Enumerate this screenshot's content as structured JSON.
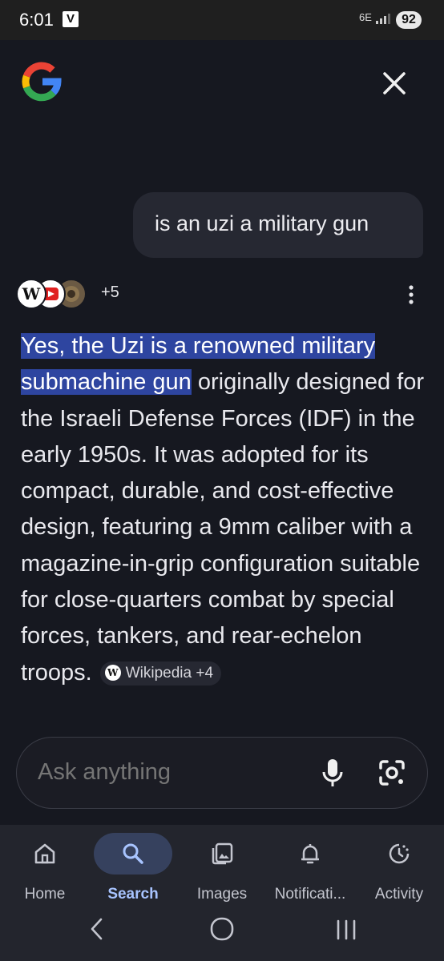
{
  "status": {
    "time": "6:01",
    "app_badge": "V",
    "network": "6E",
    "battery": "92"
  },
  "header": {
    "logo": "google-g-logo",
    "close_icon": "close-icon"
  },
  "conversation": {
    "query": "is an uzi a military gun",
    "sources": {
      "icons": [
        "wikipedia-icon",
        "youtube-icon",
        "seal-icon"
      ],
      "more": "+5"
    },
    "answer": {
      "highlight": "Yes, the Uzi is a renowned military submachine gun",
      "body": " originally designed for the Israeli Defense Forces (IDF) in the early 1950s. It was adopted for its compact, durable, and cost-effective design, featuring a 9mm caliber with a magazine-in-grip configuration suitable for close-quarters combat by special forces, tankers, and rear-echelon troops.",
      "citation": "Wikipedia +4"
    }
  },
  "ask": {
    "placeholder": "Ask anything"
  },
  "nav": {
    "items": [
      {
        "label": "Home",
        "icon": "home-icon"
      },
      {
        "label": "Search",
        "icon": "search-icon",
        "active": true
      },
      {
        "label": "Images",
        "icon": "images-icon"
      },
      {
        "label": "Notificati...",
        "icon": "bell-icon"
      },
      {
        "label": "Activity",
        "icon": "activity-icon"
      }
    ]
  },
  "colors": {
    "background": "#161820",
    "highlight": "#2e45a0",
    "active_nav": "#a8c4ff"
  }
}
